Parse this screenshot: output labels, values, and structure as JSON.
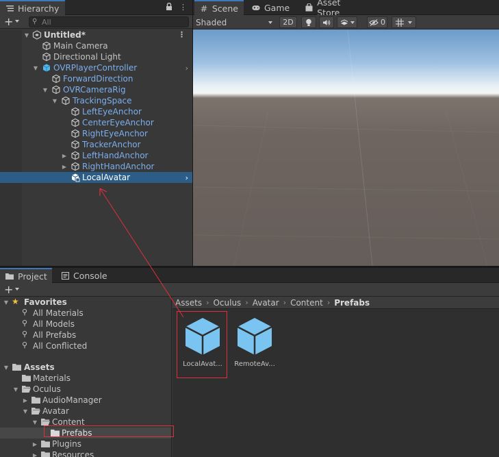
{
  "hierarchy": {
    "tab_label": "Hierarchy",
    "search_placeholder": "All",
    "items": [
      {
        "label": "Untitled*",
        "style": "bold"
      },
      {
        "label": "Main Camera",
        "style": "normal"
      },
      {
        "label": "Directional Light",
        "style": "normal"
      },
      {
        "label": "OVRPlayerController",
        "style": "blue"
      },
      {
        "label": "ForwardDirection",
        "style": "blue"
      },
      {
        "label": "OVRCameraRig",
        "style": "blue"
      },
      {
        "label": "TrackingSpace",
        "style": "blue"
      },
      {
        "label": "LeftEyeAnchor",
        "style": "blue"
      },
      {
        "label": "CenterEyeAnchor",
        "style": "blue"
      },
      {
        "label": "RightEyeAnchor",
        "style": "blue"
      },
      {
        "label": "TrackerAnchor",
        "style": "blue"
      },
      {
        "label": "LeftHandAnchor",
        "style": "blue"
      },
      {
        "label": "RightHandAnchor",
        "style": "blue"
      },
      {
        "label": "LocalAvatar",
        "style": "selected"
      }
    ]
  },
  "scene": {
    "tabs": [
      "Scene",
      "Game",
      "Asset Store"
    ],
    "shading_mode": "Shaded",
    "mode_2d": "2D",
    "hidden_count": "0"
  },
  "project": {
    "tabs": [
      "Project",
      "Console"
    ],
    "favorites": {
      "title": "Favorites",
      "items": [
        "All Materials",
        "All Models",
        "All Prefabs",
        "All Conflicted"
      ]
    },
    "assets": {
      "title": "Assets",
      "items": [
        "Materials",
        "Oculus",
        "AudioManager",
        "Avatar",
        "Content",
        "Prefabs",
        "Plugins",
        "Resources"
      ]
    },
    "breadcrumbs": [
      "Assets",
      "Oculus",
      "Avatar",
      "Content",
      "Prefabs"
    ],
    "prefabs": [
      "LocalAvat...",
      "RemoteAv..."
    ]
  },
  "colors": {
    "accent": "#3a79bb",
    "selection": "#2c5d87",
    "prefab_blue": "#7bafed",
    "annotation_red": "#e0303a"
  }
}
